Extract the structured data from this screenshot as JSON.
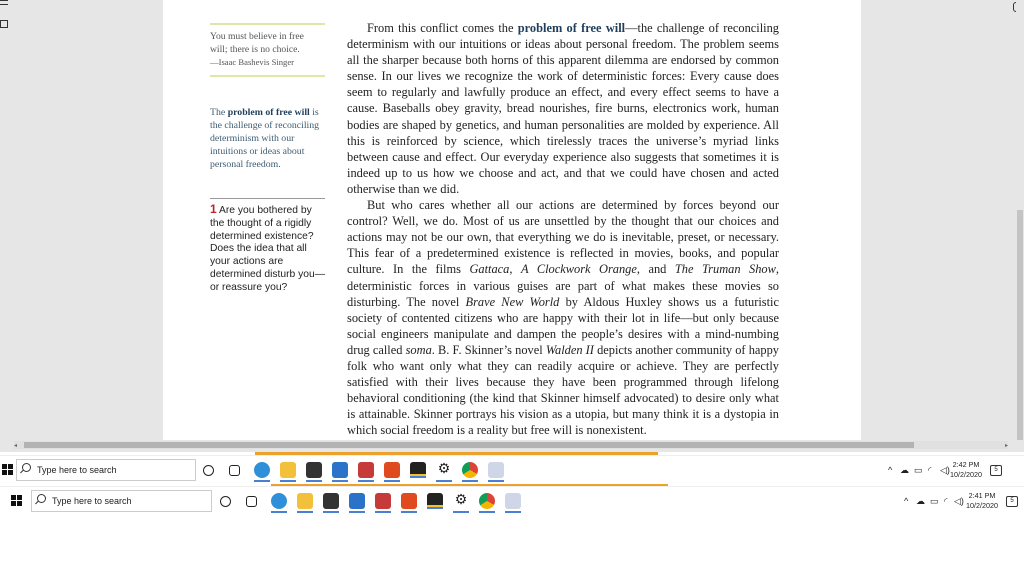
{
  "sidebar": {
    "quote_lines": [
      "You must believe in free",
      "will; there is no choice."
    ],
    "quote_author": "—Isaac Bashevis Singer",
    "definition_lead": "The ",
    "definition_term": "problem of free will",
    "definition_rest": " is the challenge of reconciling determinism with our intuitions or ideas about personal freedom.",
    "question_number": "1",
    "question_text": " Are you bothered by the thought of a rigidly determined existence? Does the idea that all your actions are determined disturb you—or reassure you?"
  },
  "body": {
    "p1_start": "From this conflict comes the ",
    "p1_term": "problem of free will",
    "p1_rest": "—the challenge of reconciling determinism with our intuitions or ideas about personal freedom. The problem seems all the sharper because both horns of this apparent dilemma are endorsed by common sense. In our lives we recognize the work of deterministic forces: Every cause does seem to regularly and lawfully produce an effect, and every effect seems to have a cause. Baseballs obey gravity, bread nourishes, fire burns, electronics work, human bodies are shaped by genetics, and human personalities are molded by experience. All this is reinforced by science, which tirelessly traces the universe’s myriad links between cause and effect. Our everyday experience also suggests that sometimes it is indeed up to us how we choose and act, and that we could have chosen and acted otherwise than we did.",
    "p2_a": "But who cares whether all our actions are determined by forces beyond our control? Well, we do. Most of us are unsettled by the thought that our choices and actions may not be our own, that everything we do is inevitable, preset, or necessary. This fear of a predetermined existence is reflected in movies, books, and popular culture. In the films ",
    "film1": "Gattaca",
    "sep1": ", ",
    "film2": "A Clockwork Orange",
    "sep2": ", and ",
    "film3": "The Truman Show",
    "p2_b": ", deterministic forces in various guises are part of what makes these movies so disturbing. The novel ",
    "novel1": "Brave New World",
    "p2_c": " by Aldous Huxley shows us a futuristic society of contented citizens who are happy with their lot in life—but only because social engineers manipulate and dampen the people’s desires with a mind-numbing drug called ",
    "soma": "soma",
    "p2_d": ". B. F. Skinner’s novel ",
    "novel2": "Walden II",
    "p2_e": " depicts another community of happy folk who want only what they can readily acquire or achieve. They are perfectly satisfied with their lives because they have been programmed through lifelong behavioral conditioning (the kind that Skinner himself advocated) to desire only what is attainable. Skinner portrays his vision as a utopia, but many think it is a dystopia in which social freedom is a reality but free will is nonexistent."
  },
  "taskbars": [
    {
      "search_placeholder": "Type here to search",
      "time": "2:42 PM",
      "date": "10/2/2020",
      "notifications": "5"
    },
    {
      "search_placeholder": "Type here to search",
      "time": "2:41 PM",
      "date": "10/2/2020",
      "notifications": "5"
    }
  ],
  "taskbar_icons": [
    "task-view-icon",
    "edge-icon",
    "file-explorer-icon",
    "store-icon",
    "mail-icon",
    "calendar-icon",
    "office-icon",
    "sticky-notes-icon",
    "settings-icon",
    "chrome-icon",
    "app-icon"
  ],
  "progress_percent": 63,
  "colors": {
    "accent": "#eba12a",
    "term": "#1f3e5c",
    "question_number": "#b8272d"
  }
}
